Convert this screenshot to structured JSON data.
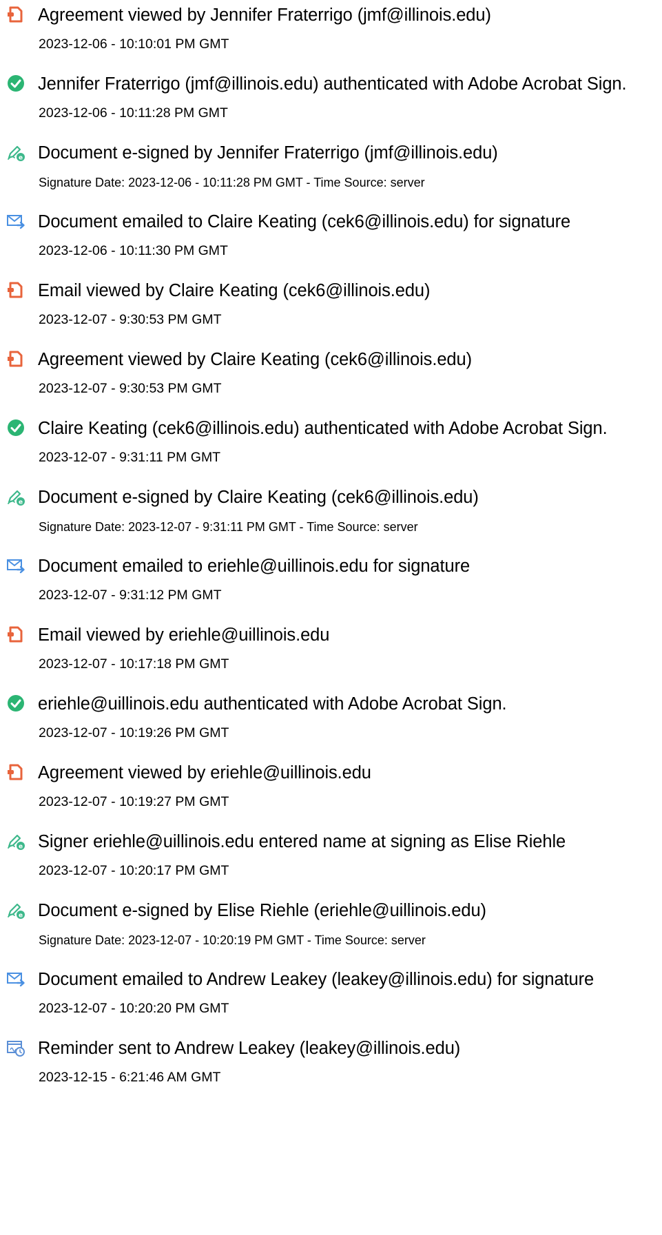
{
  "colors": {
    "viewed_icon": "#E8643C",
    "authenticated_icon": "#2BB573",
    "signed_icon": "#3DB88B",
    "emailed_icon": "#4A90E2",
    "reminder_icon": "#5B8FD6"
  },
  "events": [
    {
      "icon": "document-viewed-icon",
      "title": "Agreement viewed by Jennifer Fraterrigo (jmf@illinois.edu)",
      "detail": "2023-12-06 - 10:10:01 PM GMT"
    },
    {
      "icon": "authenticated-check-icon",
      "title": "Jennifer Fraterrigo (jmf@illinois.edu) authenticated with Adobe Acrobat Sign.",
      "detail": "2023-12-06 - 10:11:28 PM GMT"
    },
    {
      "icon": "e-signed-pen-icon",
      "title": "Document e-signed by Jennifer Fraterrigo (jmf@illinois.edu)",
      "detail": "Signature Date: 2023-12-06 - 10:11:28 PM GMT - Time Source: server"
    },
    {
      "icon": "email-sent-icon",
      "title": "Document emailed to Claire Keating (cek6@illinois.edu) for signature",
      "detail": "2023-12-06 - 10:11:30 PM GMT"
    },
    {
      "icon": "document-viewed-icon",
      "title": "Email viewed by Claire Keating (cek6@illinois.edu)",
      "detail": "2023-12-07 - 9:30:53 PM GMT"
    },
    {
      "icon": "document-viewed-icon",
      "title": "Agreement viewed by Claire Keating (cek6@illinois.edu)",
      "detail": "2023-12-07 - 9:30:53 PM GMT"
    },
    {
      "icon": "authenticated-check-icon",
      "title": "Claire Keating (cek6@illinois.edu) authenticated with Adobe Acrobat Sign.",
      "detail": "2023-12-07 - 9:31:11 PM GMT"
    },
    {
      "icon": "e-signed-pen-icon",
      "title": "Document e-signed by Claire Keating (cek6@illinois.edu)",
      "detail": "Signature Date: 2023-12-07 - 9:31:11 PM GMT - Time Source: server"
    },
    {
      "icon": "email-sent-icon",
      "title": "Document emailed to eriehle@uillinois.edu for signature",
      "detail": "2023-12-07 - 9:31:12 PM GMT"
    },
    {
      "icon": "document-viewed-icon",
      "title": "Email viewed by eriehle@uillinois.edu",
      "detail": "2023-12-07 - 10:17:18 PM GMT"
    },
    {
      "icon": "authenticated-check-icon",
      "title": "eriehle@uillinois.edu authenticated with Adobe Acrobat Sign.",
      "detail": "2023-12-07 - 10:19:26 PM GMT"
    },
    {
      "icon": "document-viewed-icon",
      "title": "Agreement viewed by eriehle@uillinois.edu",
      "detail": "2023-12-07 - 10:19:27 PM GMT"
    },
    {
      "icon": "e-signed-pen-icon",
      "title": "Signer eriehle@uillinois.edu entered name at signing as Elise Riehle",
      "detail": "2023-12-07 - 10:20:17 PM GMT"
    },
    {
      "icon": "e-signed-pen-icon",
      "title": "Document e-signed by Elise Riehle (eriehle@uillinois.edu)",
      "detail": "Signature Date: 2023-12-07 - 10:20:19 PM GMT - Time Source: server"
    },
    {
      "icon": "email-sent-icon",
      "title": "Document emailed to Andrew Leakey (leakey@illinois.edu) for signature",
      "detail": "2023-12-07 - 10:20:20 PM GMT"
    },
    {
      "icon": "reminder-clock-icon",
      "title": "Reminder sent to Andrew Leakey (leakey@illinois.edu)",
      "detail": "2023-12-15 - 6:21:46 AM GMT"
    }
  ]
}
